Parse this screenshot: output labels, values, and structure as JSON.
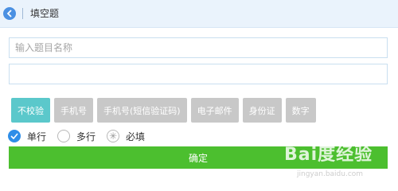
{
  "header": {
    "title": "填空题",
    "back_icon": "chevron-left-icon",
    "accent": "#4a90e2"
  },
  "form": {
    "name_placeholder": "输入题目名称",
    "second_value": ""
  },
  "validation": {
    "buttons": [
      {
        "label": "不校验",
        "active": true
      },
      {
        "label": "手机号",
        "active": false
      },
      {
        "label": "手机号(短信验证码)",
        "active": false
      },
      {
        "label": "电子邮件",
        "active": false
      },
      {
        "label": "身份证",
        "active": false
      },
      {
        "label": "数字",
        "active": false
      }
    ],
    "active_color": "#5bc8cb",
    "inactive_color": "#c8c8c8"
  },
  "options": {
    "single_line": "单行",
    "multi_line": "多行",
    "required": "必填",
    "selected": "单行"
  },
  "confirm": {
    "label": "确定",
    "color": "#4cbf2f"
  },
  "watermark": {
    "brand": "Bai度经验",
    "url": "jingyan.baidu.com"
  }
}
